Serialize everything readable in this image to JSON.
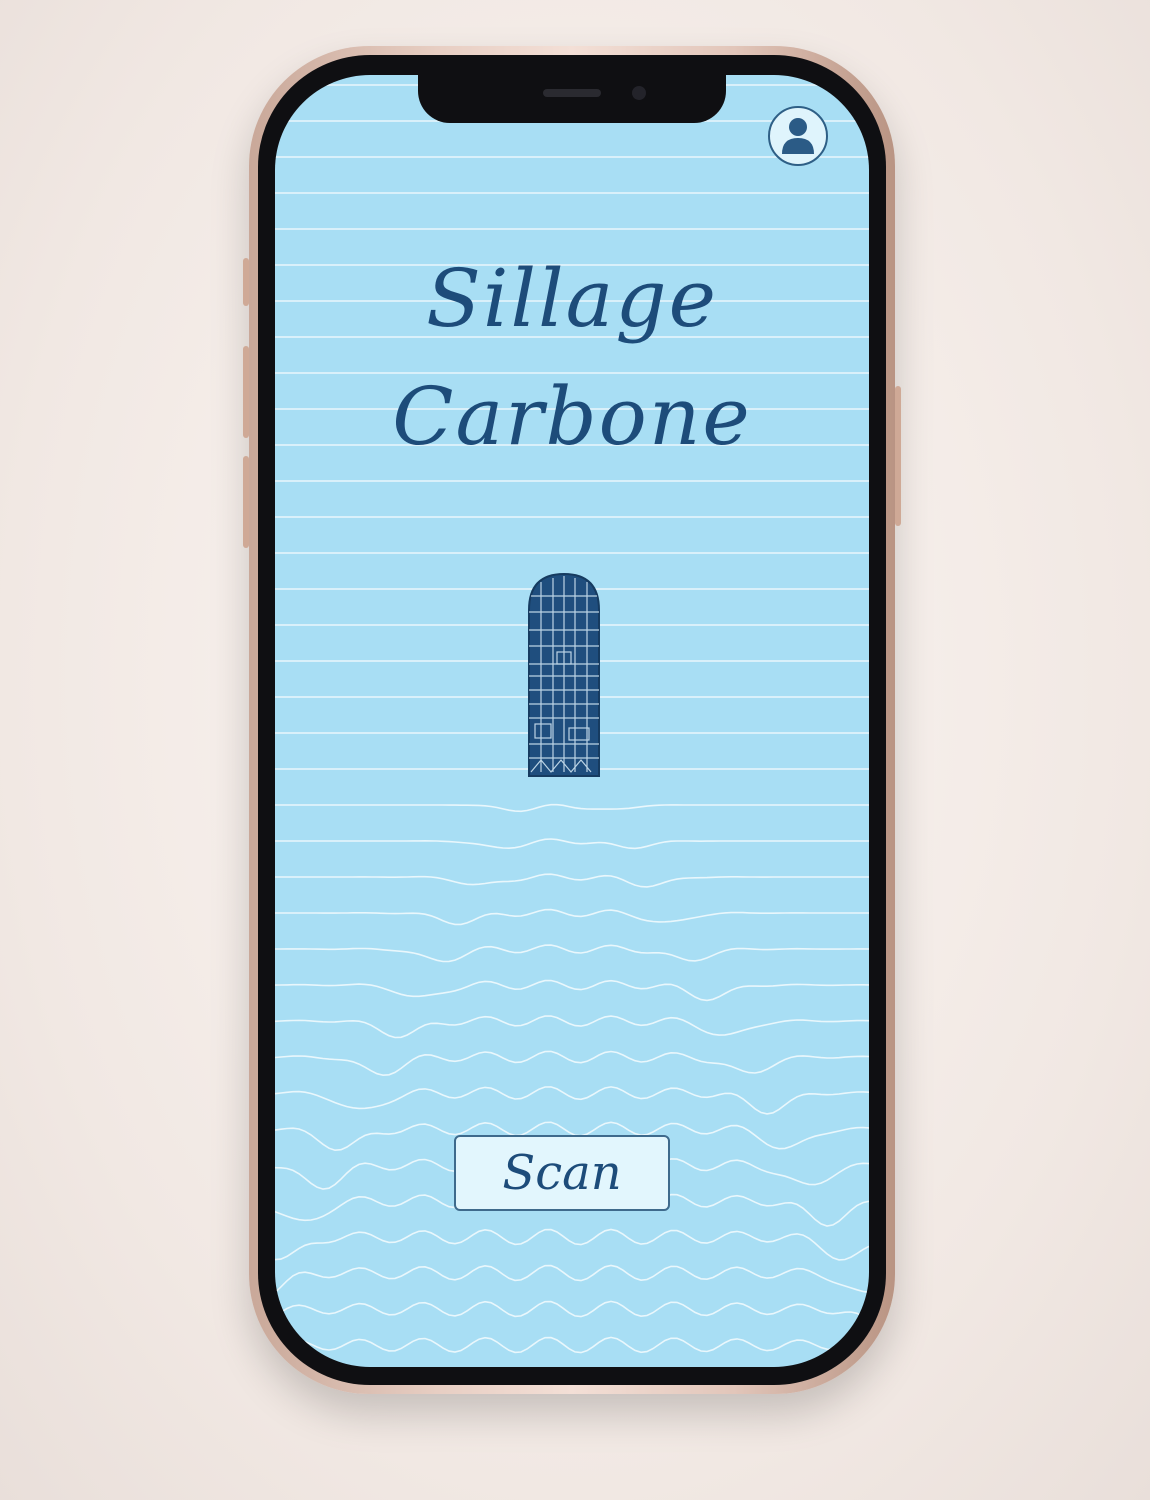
{
  "app": {
    "title_line1": "Sillage",
    "title_line2": "Carbone",
    "scan_label": "Scan",
    "profile_icon": "user-icon"
  },
  "colors": {
    "screen_background": "#a8def4",
    "ink": "#1d4c7a",
    "button_background": "#e2f6fd",
    "lines": "#ffffff"
  }
}
